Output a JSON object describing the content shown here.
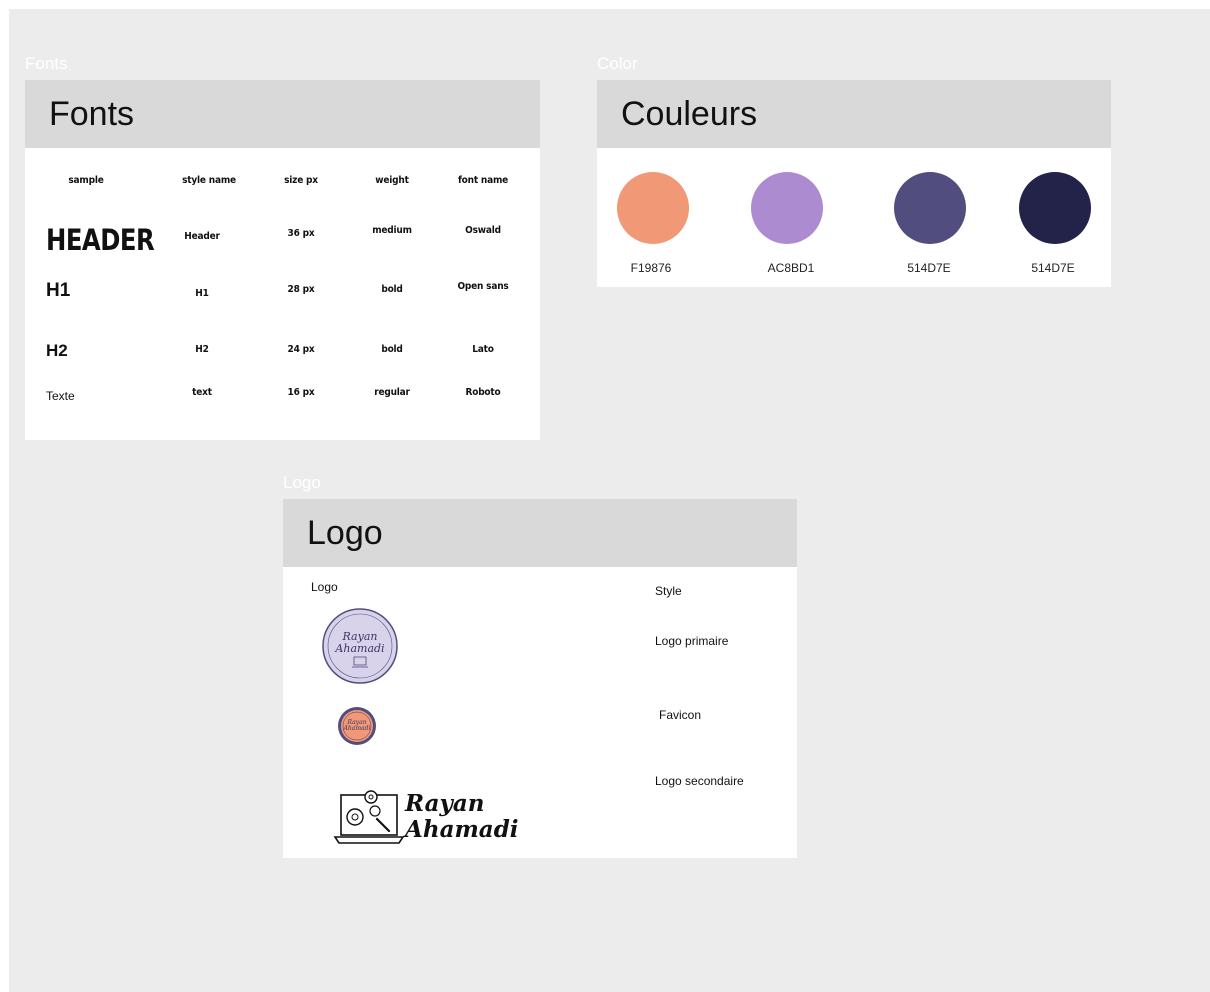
{
  "frames": {
    "fonts_label": "Fonts",
    "color_label": "Color",
    "logo_label": "Logo"
  },
  "fonts_card": {
    "title": "Fonts",
    "columns": [
      "sample",
      "style name",
      "size px",
      "weight",
      "font name"
    ],
    "rows": [
      {
        "sample": "HEADER",
        "style": "Header",
        "size": "36 px",
        "weight": "medium",
        "font": "Oswald"
      },
      {
        "sample": "H1",
        "style": "H1",
        "size": "28 px",
        "weight": "bold",
        "font": "Open sans"
      },
      {
        "sample": "H2",
        "style": "H2",
        "size": "24 px",
        "weight": "bold",
        "font": "Lato"
      },
      {
        "sample": "Texte",
        "style": "text",
        "size": "16 px",
        "weight": "regular",
        "font": "Roboto"
      }
    ]
  },
  "colors_card": {
    "title": "Couleurs",
    "swatches": [
      {
        "label": "F19876",
        "color": "#F19876"
      },
      {
        "label": "AC8BD1",
        "color": "#AC8BD1"
      },
      {
        "label": "514D7E",
        "color": "#514D7E"
      },
      {
        "label": "514D7E",
        "color": "#23234A"
      }
    ]
  },
  "logo_card": {
    "title": "Logo",
    "col_logo": "Logo",
    "col_style": "Style",
    "primary_label": "Logo primaire",
    "favicon_label": "Favicon",
    "secondary_label": "Logo secondaire",
    "brand_line1": "Rayan",
    "brand_line2": "Ahamadi"
  }
}
